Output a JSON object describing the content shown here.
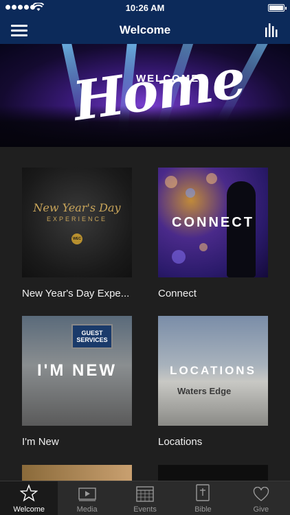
{
  "status_bar": {
    "time": "10:26 AM"
  },
  "nav": {
    "title": "Welcome"
  },
  "hero": {
    "small_text": "WELCOME",
    "big_text": "Home"
  },
  "tiles": [
    {
      "caption": "New Year's Day Expe...",
      "overlay": "",
      "art_title": "New Year's Day",
      "art_sub": "EXPERIENCE",
      "art_logo": "WEC"
    },
    {
      "caption": "Connect",
      "overlay": "CONNECT"
    },
    {
      "caption": "I'm New",
      "overlay": "I'M NEW",
      "sign": "GUEST SERVICES"
    },
    {
      "caption": "Locations",
      "overlay": "LOCATIONS",
      "sign": "Waters Edge"
    }
  ],
  "tab_bar": {
    "tabs": [
      {
        "label": "Welcome",
        "icon": "star-icon",
        "active": true
      },
      {
        "label": "Media",
        "icon": "video-icon",
        "active": false
      },
      {
        "label": "Events",
        "icon": "calendar-icon",
        "active": false
      },
      {
        "label": "Bible",
        "icon": "bible-icon",
        "active": false
      },
      {
        "label": "Give",
        "icon": "heart-icon",
        "active": false
      }
    ]
  },
  "colors": {
    "nav_bg": "#0c2a5a",
    "page_bg": "#1f1f1f",
    "tab_bg": "#2b2b2b",
    "tab_active_bg": "#1a1a1a"
  }
}
